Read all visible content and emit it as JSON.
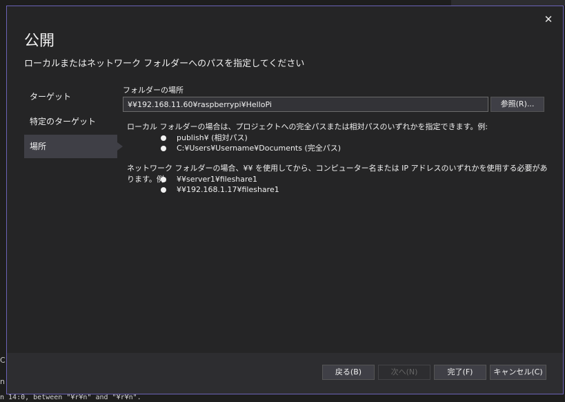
{
  "background": {
    "status_text": "n 14:0, between \"¥r¥n\" and \"¥r¥n\".",
    "left_chars": [
      "C",
      "n"
    ]
  },
  "dialog": {
    "title": "公開",
    "subtitle": "ローカルまたはネットワーク フォルダーへのパスを指定してください",
    "close_glyph": "✕"
  },
  "nav": {
    "items": [
      {
        "label": "ターゲット",
        "selected": false
      },
      {
        "label": "特定のターゲット",
        "selected": false
      },
      {
        "label": "場所",
        "selected": true
      }
    ]
  },
  "form": {
    "folder_label": "フォルダーの場所",
    "path_value": "¥¥192.168.11.60¥raspberrypi¥HelloPi",
    "browse_label": "参照(R)..."
  },
  "hints": {
    "local_intro": "ローカル フォルダーの場合は、プロジェクトへの完全パスまたは相対パスのいずれかを指定できます。例:",
    "local_examples": [
      "publish¥ (相対パス)",
      "C:¥Users¥Username¥Documents (完全パス)"
    ],
    "network_intro": "ネットワーク フォルダーの場合、¥¥ を使用してから、コンピューター名または IP アドレスのいずれかを使用する必要があります。例:",
    "network_examples": [
      "¥¥server1¥fileshare1",
      "¥¥192.168.1.17¥fileshare1"
    ]
  },
  "footer": {
    "back_label": "戻る(B)",
    "next_label": "次へ(N)",
    "finish_label": "完了(F)",
    "cancel_label": "キャンセル(C)"
  },
  "colors": {
    "dialog_bg": "#252526",
    "border_accent": "#6c63b8",
    "selected_nav": "#3f3f46",
    "footer_bg": "#2d2d30"
  }
}
